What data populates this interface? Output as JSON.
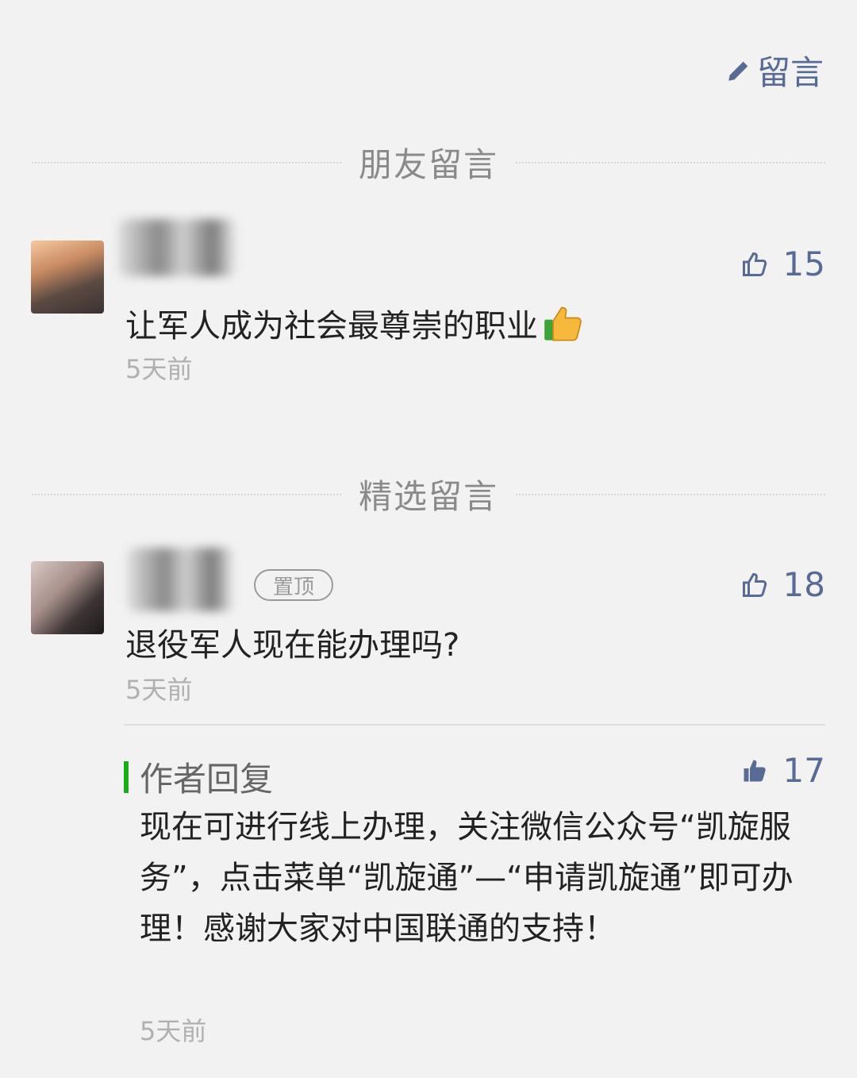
{
  "write": {
    "label": "留言",
    "icon": "pencil-icon"
  },
  "sections": {
    "friends": {
      "title": "朋友留言"
    },
    "featured": {
      "title": "精选留言"
    }
  },
  "comments": [
    {
      "text": "让军人成为社会最尊崇的职业",
      "emoji": "thumbs-up-emoji",
      "time": "5天前",
      "likes": "15"
    },
    {
      "badge": "置顶",
      "text": "退役军人现在能办理吗?",
      "time": "5天前",
      "likes": "18",
      "reply": {
        "label": "作者回复",
        "likes": "17",
        "text": "现在可进行线上办理，关注微信公众号“凯旋服务”，点击菜单“凯旋通”—“申请凯旋通”即可办理！感谢大家对中国联通的支持！",
        "time": "5天前"
      }
    }
  ],
  "colors": {
    "link": "#576b95",
    "reply_accent": "#1aad19",
    "background": "#f2f2f2"
  }
}
